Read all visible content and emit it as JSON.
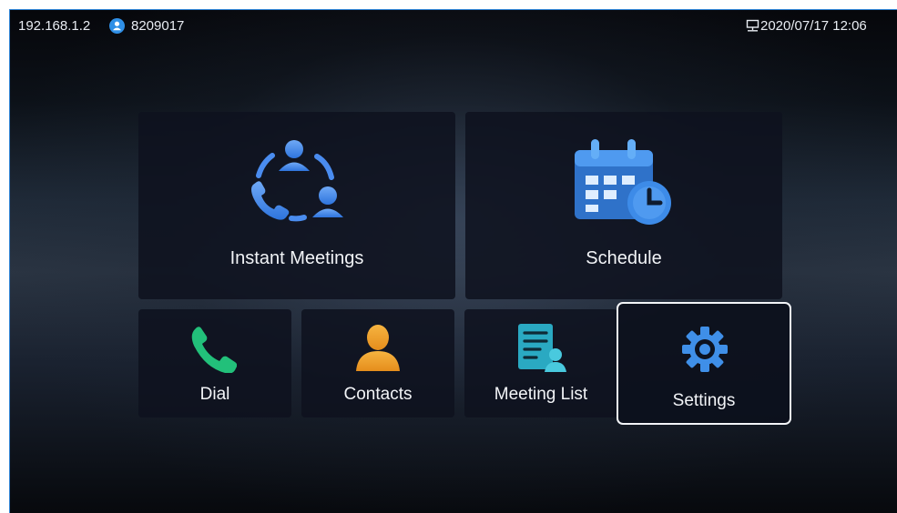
{
  "status_bar": {
    "ip_address": "192.168.1.2",
    "account_number": "8209017",
    "datetime": "2020/07/17 12:06"
  },
  "tiles": {
    "instant_meetings": {
      "label": "Instant Meetings",
      "icon": "instant-meetings-icon"
    },
    "schedule": {
      "label": "Schedule",
      "icon": "calendar-clock-icon"
    },
    "dial": {
      "label": "Dial",
      "icon": "phone-icon"
    },
    "contacts": {
      "label": "Contacts",
      "icon": "person-icon"
    },
    "meeting_list": {
      "label": "Meeting List",
      "icon": "meeting-list-icon"
    },
    "settings": {
      "label": "Settings",
      "icon": "gear-icon",
      "selected": true
    }
  },
  "colors": {
    "accent_blue": "#2f8fe6",
    "dial_green": "#22c07a",
    "contacts_orange": "#f0a22a",
    "list_teal": "#2fb3c9",
    "tile_bg": "#0e121e",
    "selection_border": "#f3f5f8"
  }
}
